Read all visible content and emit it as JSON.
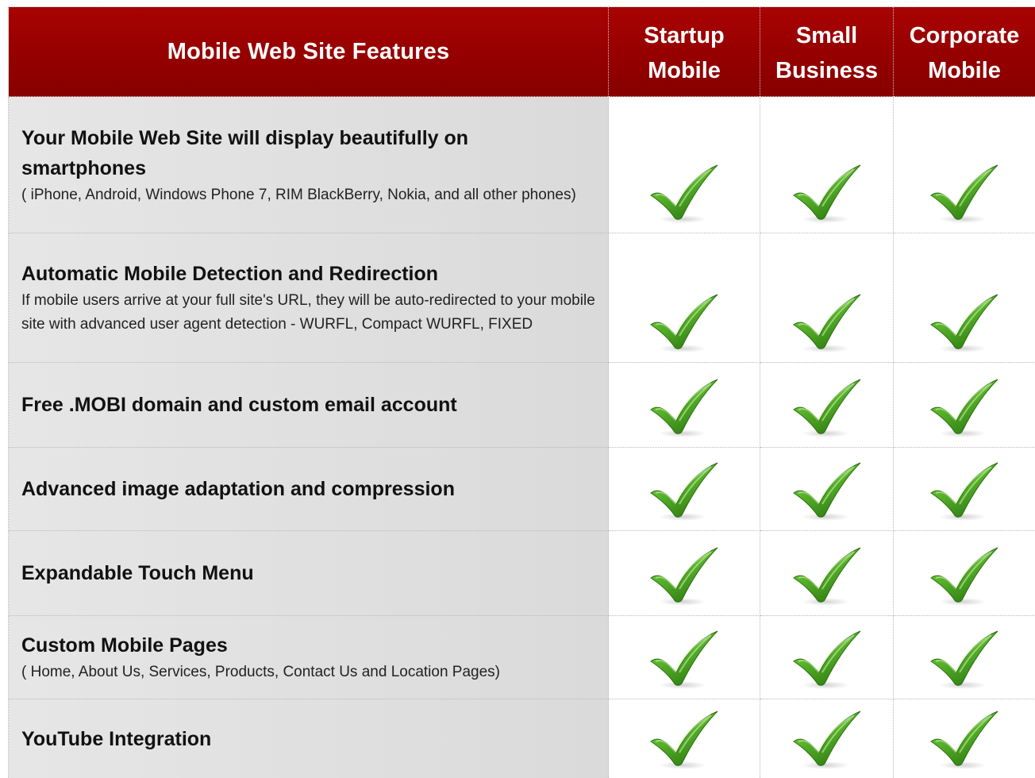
{
  "header": {
    "feature_column": "Mobile Web Site Features",
    "plans": [
      {
        "line1": "Startup",
        "line2": "Mobile"
      },
      {
        "line1": "Small",
        "line2": "Business"
      },
      {
        "line1": "Corporate",
        "line2": "Mobile"
      }
    ]
  },
  "rows": [
    {
      "title": "Your Mobile Web Site will display beautifully on smartphones",
      "description": "( iPhone, Android, Windows Phone 7, RIM BlackBerry, Nokia, and all other phones)",
      "included": [
        true,
        true,
        true
      ]
    },
    {
      "title": "Automatic Mobile Detection and Redirection",
      "description": "If mobile users arrive at your full site's URL, they will be auto-redirected to your mobile site with advanced user agent detection - WURFL, Compact WURFL, FIXED",
      "included": [
        true,
        true,
        true
      ]
    },
    {
      "title": "Free .MOBI domain and custom email account",
      "description": "",
      "included": [
        true,
        true,
        true
      ]
    },
    {
      "title": "Advanced image adaptation and compression",
      "description": "",
      "included": [
        true,
        true,
        true
      ]
    },
    {
      "title": "Expandable Touch Menu",
      "description": "",
      "included": [
        true,
        true,
        true
      ]
    },
    {
      "title": "Custom Mobile Pages",
      "description": "( Home, About Us, Services, Products, Contact Us and Location Pages)",
      "included": [
        true,
        true,
        true
      ]
    },
    {
      "title": "YouTube Integration",
      "description": "",
      "included": [
        true,
        true,
        true
      ]
    }
  ],
  "icons": {
    "included": "check-icon"
  },
  "colors": {
    "header_bg": "#950000",
    "header_text": "#ffffff",
    "feature_bg": "#dcdcdc",
    "check_green": "#5cb82c"
  }
}
